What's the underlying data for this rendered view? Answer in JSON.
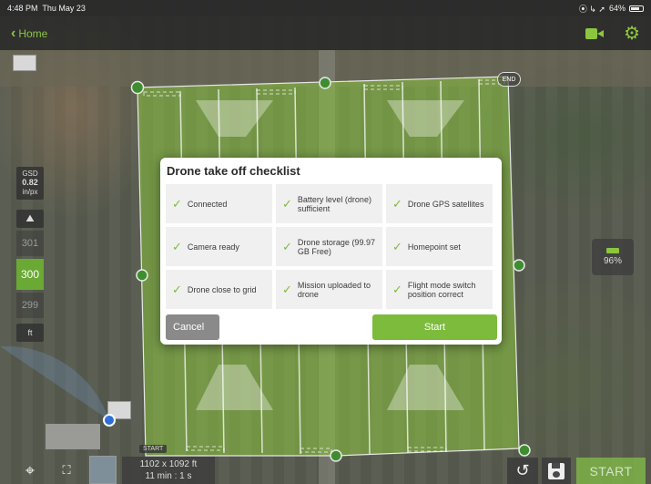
{
  "status_bar": {
    "time": "4:48 PM",
    "date": "Thu May 23",
    "icons": "⦿ ↳ ➚",
    "battery": "64%"
  },
  "nav": {
    "back_label": "Home",
    "icons": [
      "camera-icon",
      "gear-icon"
    ]
  },
  "grid": {
    "end_label": "END",
    "start_label": "START",
    "accent": "#8cc63f"
  },
  "left_panel": {
    "gsd_label": "GSD",
    "gsd_value": "0.82",
    "gsd_unit": "in/px",
    "altitude_up": "301",
    "altitude_current": "300",
    "altitude_down": "299",
    "altitude_unit": "ft"
  },
  "right_panel": {
    "drone_battery": "96%"
  },
  "bottom": {
    "dimensions": "1102 x 1092 ft",
    "duration": "11 min : 1 s",
    "start_button": "START"
  },
  "dialog": {
    "title": "Drone take off checklist",
    "items": [
      {
        "label": "Connected"
      },
      {
        "label": "Battery level (drone) sufficient"
      },
      {
        "label": "Drone GPS satellites"
      },
      {
        "label": "Camera ready"
      },
      {
        "label": "Drone storage (99.97 GB Free)"
      },
      {
        "label": "Homepoint set"
      },
      {
        "label": "Drone close to grid"
      },
      {
        "label": "Mission uploaded to drone"
      },
      {
        "label": "Flight mode switch position correct"
      }
    ],
    "cancel_label": "Cancel",
    "start_label": "Start"
  },
  "colors": {
    "accent_green": "#7dbb3c",
    "cancel_gray": "#8a8a8a"
  }
}
